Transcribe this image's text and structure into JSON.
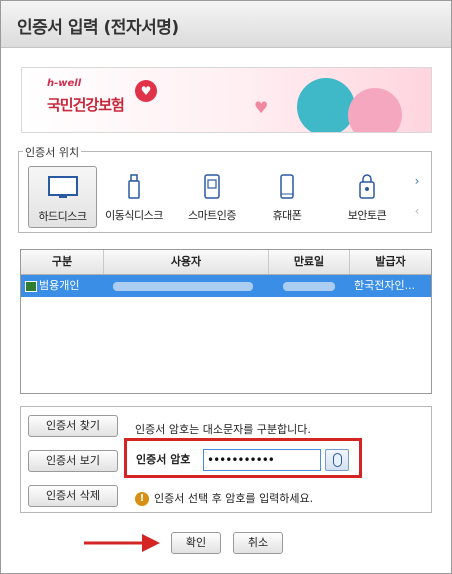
{
  "window": {
    "title": "인증서 입력 (전자서명)"
  },
  "banner": {
    "brand_small": "h-well",
    "brand": "국민건강보험"
  },
  "location": {
    "legend": "인증서 위치",
    "items": [
      {
        "label": "하드디스크",
        "icon": "hard-disk-icon"
      },
      {
        "label": "이동식디스크",
        "icon": "usb-icon"
      },
      {
        "label": "스마트인증",
        "icon": "smart-cert-icon"
      },
      {
        "label": "휴대폰",
        "icon": "mobile-phone-icon"
      },
      {
        "label": "보안토큰",
        "icon": "security-token-icon"
      }
    ]
  },
  "table": {
    "headers": [
      "구분",
      "사용자",
      "만료일",
      "발급자"
    ],
    "rows": [
      {
        "type": "범용개인",
        "issuer": "한국전자인..."
      }
    ]
  },
  "buttons": {
    "find": "인증서 찾기",
    "view": "인증서 보기",
    "delete": "인증서 삭제",
    "ok": "확인",
    "cancel": "취소"
  },
  "password": {
    "hint": "인증서 암호는 대소문자를 구분합니다.",
    "label": "인증서 암호",
    "value": "•••••••••••",
    "warning": "인증서 선택 후 암호를 입력하세요."
  },
  "colors": {
    "selection": "#3a8ee6",
    "highlight": "#d42424",
    "arrow": "#d42424"
  }
}
